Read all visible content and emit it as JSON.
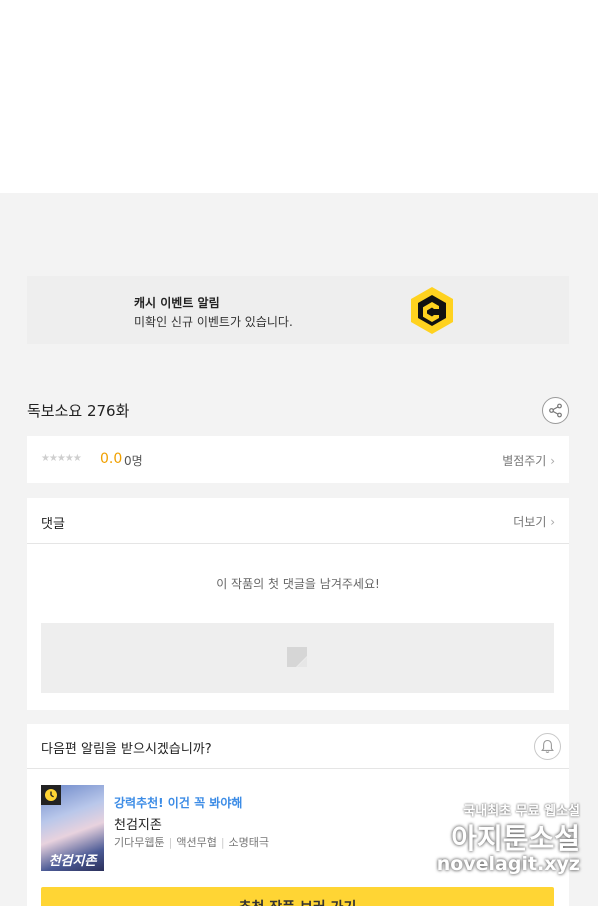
{
  "banner": {
    "title": "캐시 이벤트 알림",
    "subtitle": "미확인 신규 이벤트가 있습니다.",
    "logo_letter": "C",
    "logo_color": "#ffd21f"
  },
  "episode": {
    "title": "독보소요 276화"
  },
  "rating": {
    "stars": "★★★★★",
    "score": "0.0",
    "count": "0명",
    "action_label": "별점주기",
    "score_color": "#f0a000"
  },
  "comments": {
    "title": "댓글",
    "more_label": "더보기",
    "empty_text": "이 작품의 첫 댓글을 남겨주세요!"
  },
  "notify": {
    "title": "다음편 알림을 받으시겠습니까?",
    "recommend": {
      "tag": "강력추천! 이건 꼭 봐야해",
      "name": "천검지존",
      "genres": [
        "기다무웹툰",
        "액션무협",
        "소명태극"
      ],
      "thumb_text": "천검지존",
      "tag_color": "#3c8ce6"
    },
    "button_label": "추천 작품 보러 가기",
    "button_color": "#ffd534"
  },
  "watermark": {
    "line1": "국내최초 무료 웹소설",
    "line2": "아지툰소설",
    "line3": "novelagit.xyz"
  }
}
